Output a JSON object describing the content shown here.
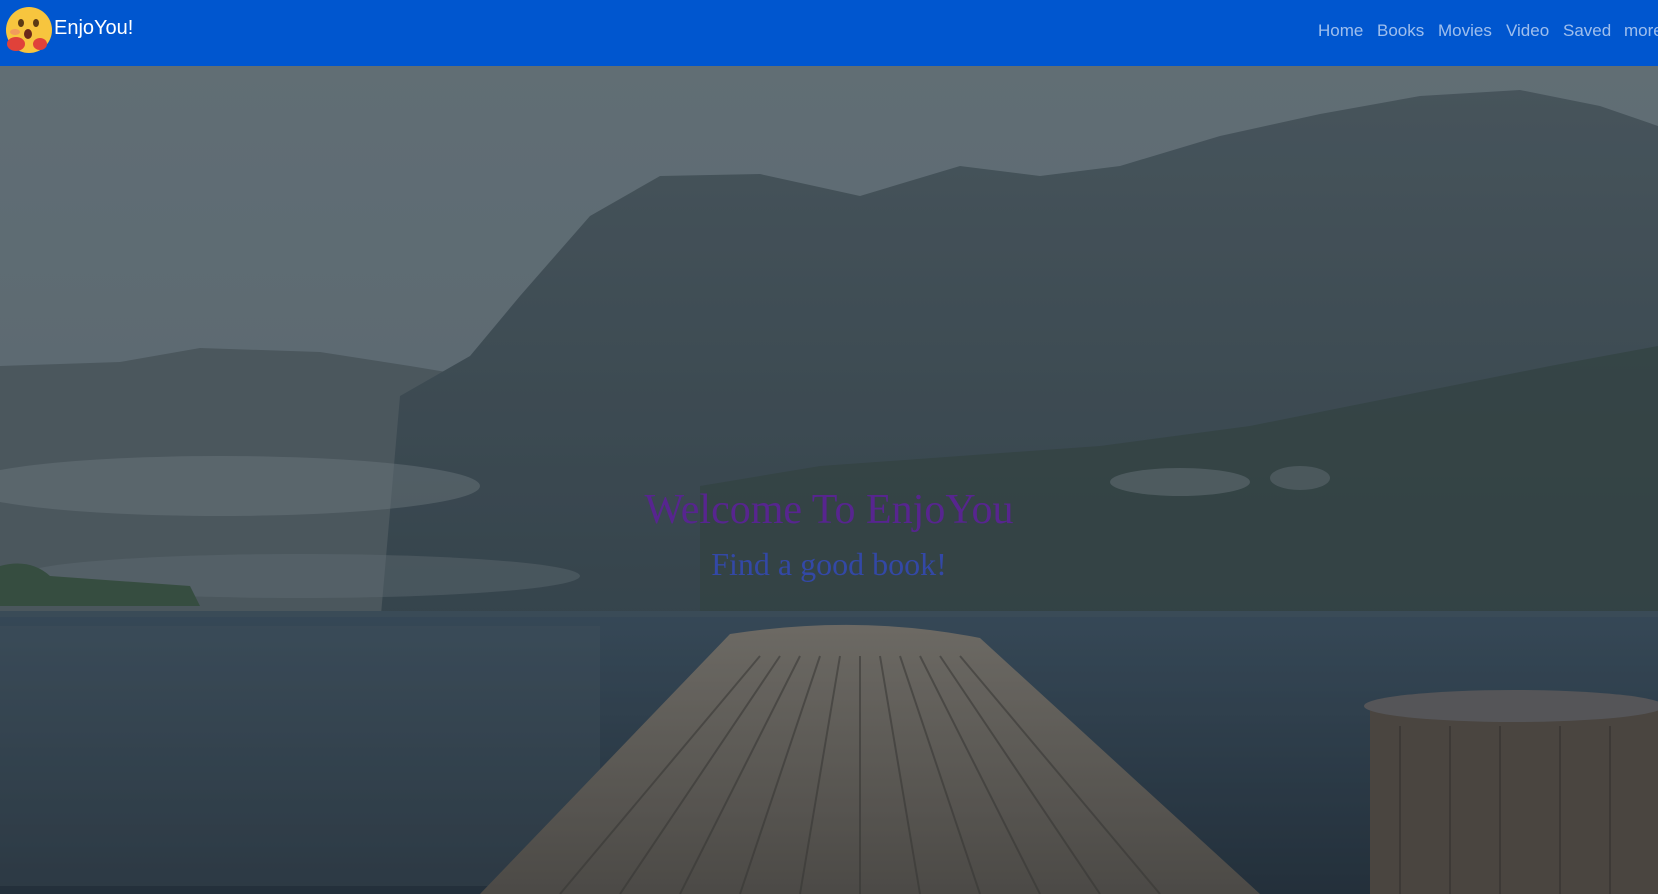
{
  "navbar": {
    "brand": "EnjoYou!",
    "background": "#0056cf",
    "logo_icon": "hugging-face-emoji",
    "links": [
      {
        "label": "Home"
      },
      {
        "label": "Books"
      },
      {
        "label": "Movies"
      },
      {
        "label": "Video"
      },
      {
        "label": "Saved"
      },
      {
        "label": "more"
      }
    ]
  },
  "hero": {
    "title": "Welcome To EnjoYou",
    "subtitle": "Find a good book!",
    "title_color": "#57258f",
    "subtitle_color": "#3348a6"
  }
}
